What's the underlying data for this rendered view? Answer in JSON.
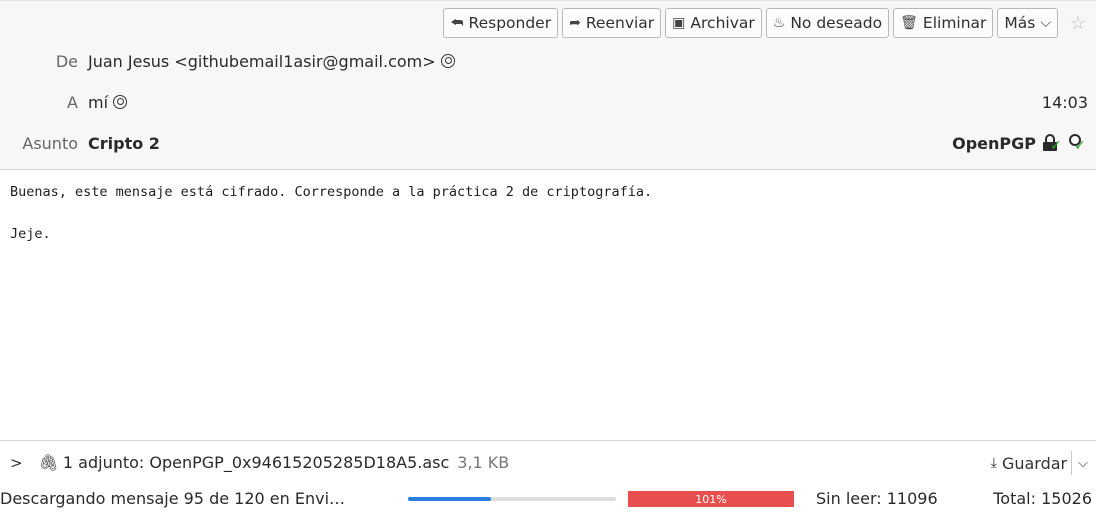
{
  "toolbar": {
    "reply": "Responder",
    "forward": "Reenviar",
    "archive": "Archivar",
    "junk": "No deseado",
    "delete": "Eliminar",
    "more": "Más"
  },
  "header": {
    "from_label": "De",
    "from_value": "Juan Jesus <githubemail1asir@gmail.com>",
    "to_label": "A",
    "to_value": "mí",
    "time": "14:03",
    "subject_label": "Asunto",
    "subject_value": "Cripto 2",
    "security_label": "OpenPGP"
  },
  "body": {
    "lines": [
      "Buenas, este mensaje está cifrado. Corresponde a la práctica 2 de criptografía.",
      "Jeje."
    ]
  },
  "attachment": {
    "label": "1 adjunto: OpenPGP_0x94615205285D18A5.asc",
    "size": "3,1 KB",
    "save_label": "Guardar"
  },
  "status": {
    "text": "Descargando mensaje 95 de 120 en Envi…",
    "progress_fraction": 0.4,
    "memory_label": "101%",
    "unread": "Sin leer: 11096",
    "total": "Total: 15026"
  },
  "icons": {
    "reply": "reply-icon",
    "forward": "forward-icon",
    "archive": "archive-icon",
    "junk": "junk-icon",
    "delete": "trash-icon",
    "star": "star-icon",
    "attachment": "paperclip-icon",
    "save": "download-icon"
  },
  "colors": {
    "progress": "#2a7fe0",
    "memory_bar": "#e94f4f",
    "verified": "#26a626"
  }
}
